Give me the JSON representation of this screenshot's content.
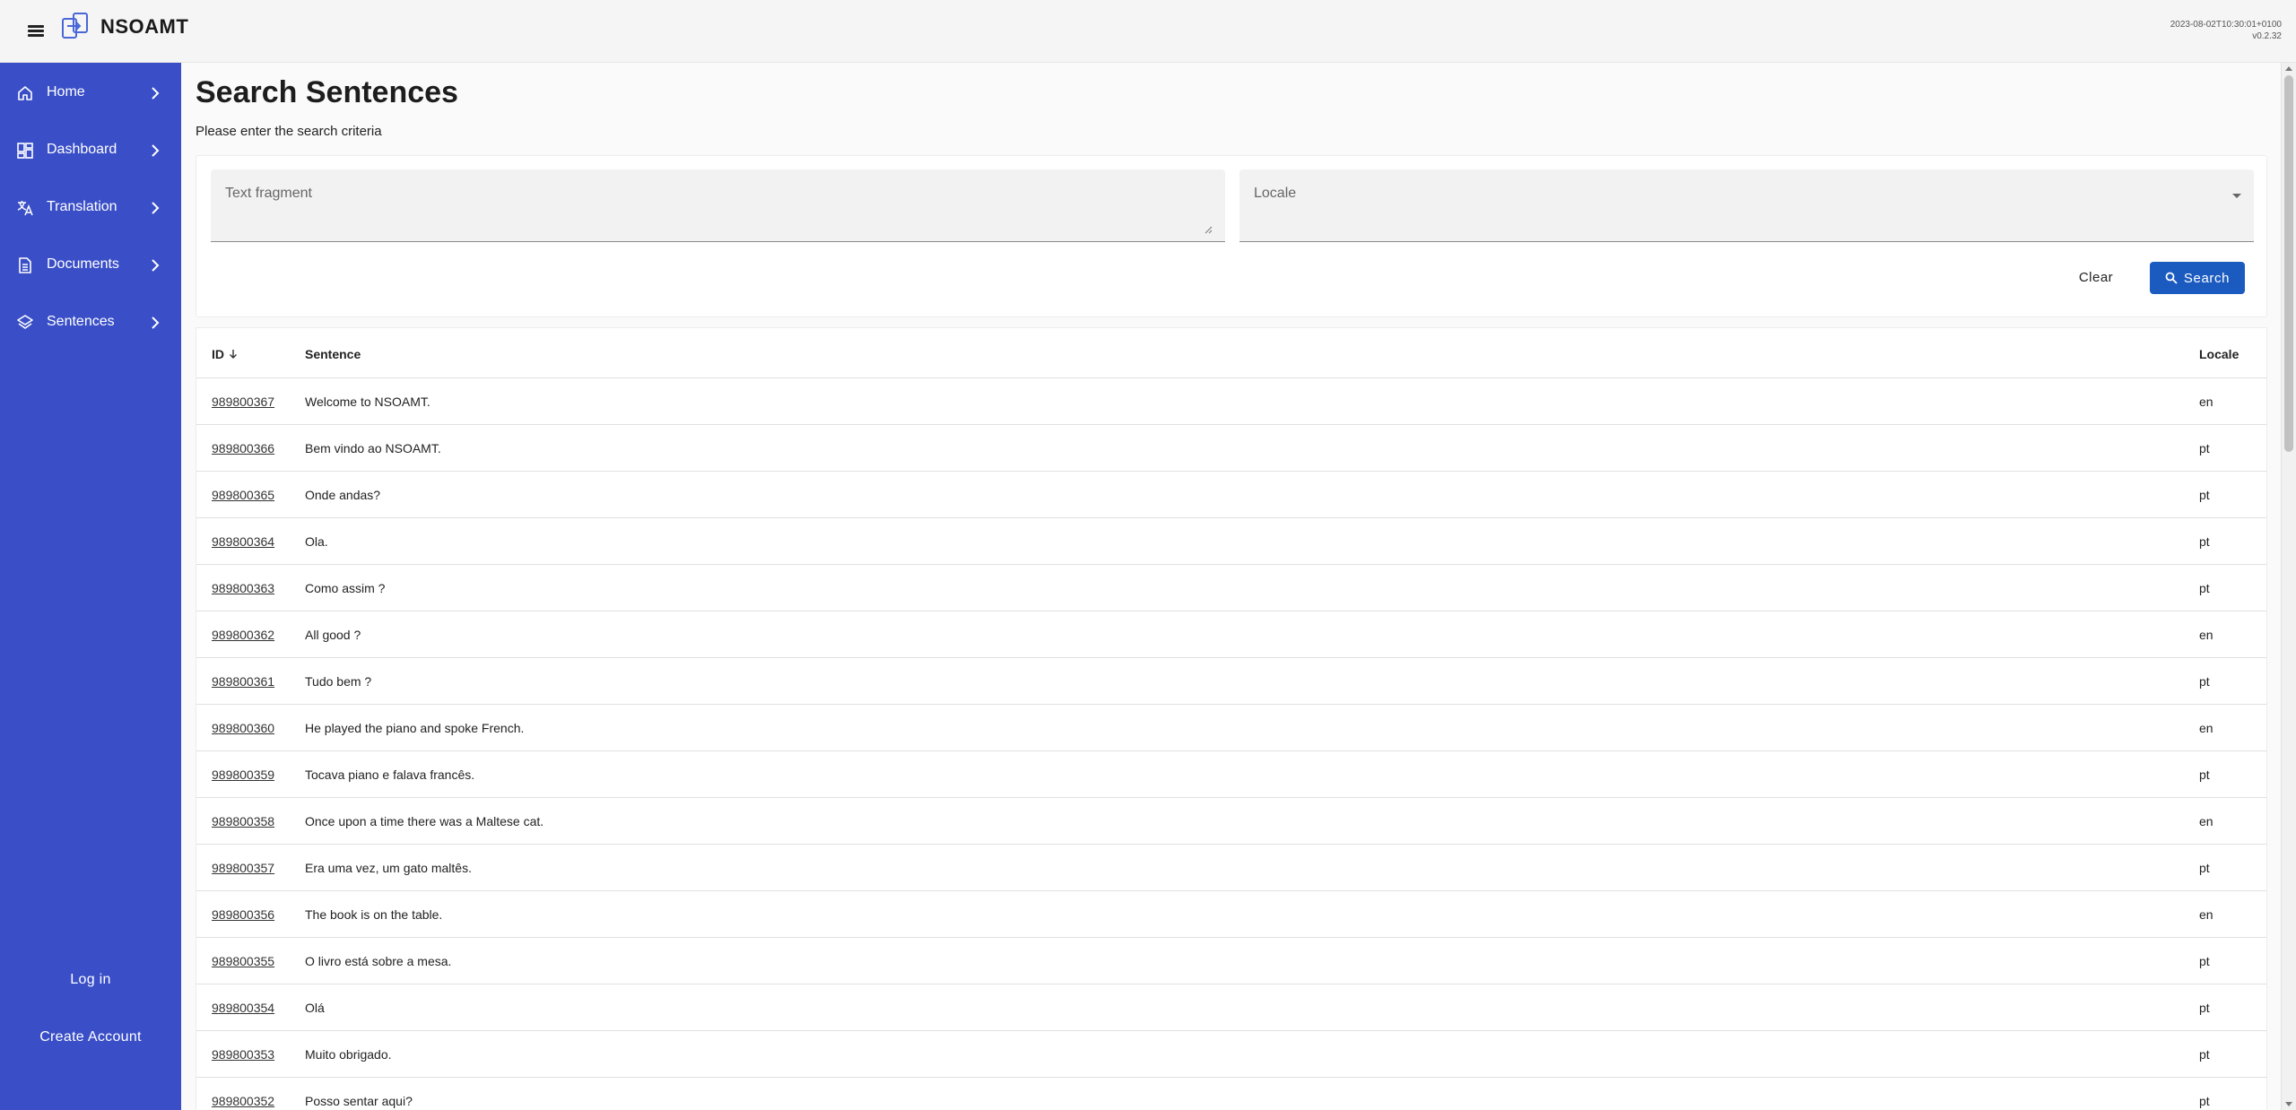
{
  "header": {
    "app_name": "NSOAMT",
    "build_timestamp": "2023-08-02T10:30:01+0100",
    "version": "v0.2.32"
  },
  "sidebar": {
    "items": [
      {
        "label": "Home",
        "icon": "home-icon"
      },
      {
        "label": "Dashboard",
        "icon": "dashboard-icon"
      },
      {
        "label": "Translation",
        "icon": "translate-icon"
      },
      {
        "label": "Documents",
        "icon": "document-icon"
      },
      {
        "label": "Sentences",
        "icon": "layers-icon"
      }
    ],
    "login_label": "Log in",
    "create_account_label": "Create Account"
  },
  "page": {
    "title": "Search Sentences",
    "subtitle": "Please enter the search criteria"
  },
  "search": {
    "text_fragment_label": "Text fragment",
    "locale_label": "Locale",
    "clear_label": "Clear",
    "search_label": "Search"
  },
  "table": {
    "columns": [
      "ID",
      "Sentence",
      "Locale"
    ],
    "sort_column": "ID",
    "sort_direction": "descending",
    "rows": [
      {
        "id": "989800367",
        "sentence": "Welcome to NSOAMT.",
        "locale": "en"
      },
      {
        "id": "989800366",
        "sentence": "Bem vindo ao NSOAMT.",
        "locale": "pt"
      },
      {
        "id": "989800365",
        "sentence": "Onde andas?",
        "locale": "pt"
      },
      {
        "id": "989800364",
        "sentence": "Ola.",
        "locale": "pt"
      },
      {
        "id": "989800363",
        "sentence": "Como assim ?",
        "locale": "pt"
      },
      {
        "id": "989800362",
        "sentence": "All good ?",
        "locale": "en"
      },
      {
        "id": "989800361",
        "sentence": "Tudo bem ?",
        "locale": "pt"
      },
      {
        "id": "989800360",
        "sentence": "He played the piano and spoke French.",
        "locale": "en"
      },
      {
        "id": "989800359",
        "sentence": "Tocava piano e falava francês.",
        "locale": "pt"
      },
      {
        "id": "989800358",
        "sentence": "Once upon a time there was a Maltese cat.",
        "locale": "en"
      },
      {
        "id": "989800357",
        "sentence": "Era uma vez, um gato maltês.",
        "locale": "pt"
      },
      {
        "id": "989800356",
        "sentence": "The book is on the table.",
        "locale": "en"
      },
      {
        "id": "989800355",
        "sentence": "O livro está sobre a mesa.",
        "locale": "pt"
      },
      {
        "id": "989800354",
        "sentence": "Olá",
        "locale": "pt"
      },
      {
        "id": "989800353",
        "sentence": "Muito obrigado.",
        "locale": "pt"
      },
      {
        "id": "989800352",
        "sentence": "Posso sentar aqui?",
        "locale": "pt"
      }
    ]
  },
  "colors": {
    "sidebar_bg": "#3a4fc7",
    "primary_button": "#1b5bc0",
    "topbar_bg": "#f5f5f5"
  }
}
